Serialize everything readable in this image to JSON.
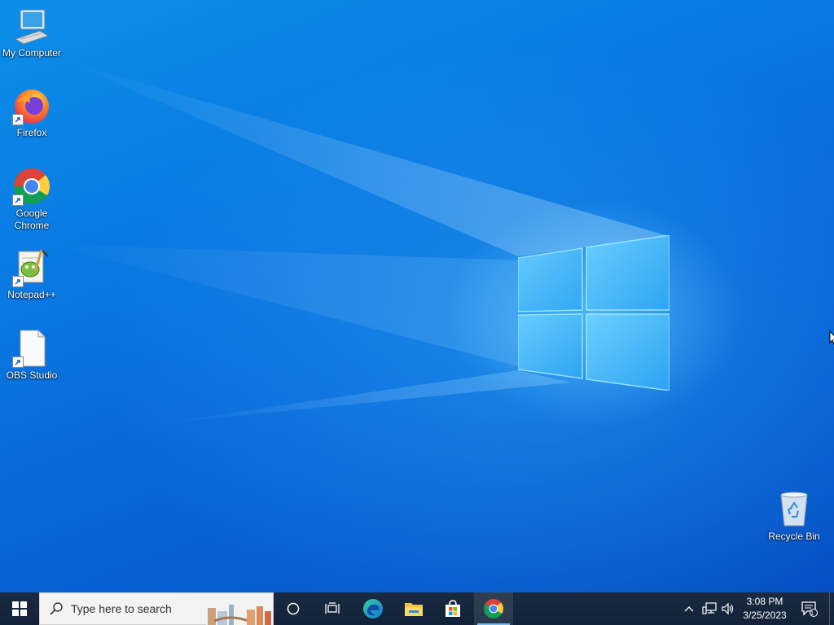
{
  "desktop": {
    "icons": [
      {
        "label": "My Computer",
        "icon": "computer-icon"
      },
      {
        "label": "Firefox",
        "icon": "firefox-icon"
      },
      {
        "label": "Google Chrome",
        "icon": "chrome-icon"
      },
      {
        "label": "Notepad++",
        "icon": "notepadpp-icon"
      },
      {
        "label": "OBS Studio",
        "icon": "file-icon"
      },
      {
        "label": "Recycle Bin",
        "icon": "recycle-bin-icon"
      }
    ]
  },
  "taskbar": {
    "search_placeholder": "Type here to search",
    "pinned": [
      "cortana-icon",
      "task-view-icon",
      "edge-icon",
      "file-explorer-icon",
      "store-icon",
      "chrome-icon"
    ],
    "active_app": "Google Chrome"
  },
  "tray": {
    "time": "3:08 PM",
    "date": "3/25/2023",
    "notification_count": "1"
  },
  "colors": {
    "accent": "#0a78e2",
    "taskbar": "#14243a"
  }
}
